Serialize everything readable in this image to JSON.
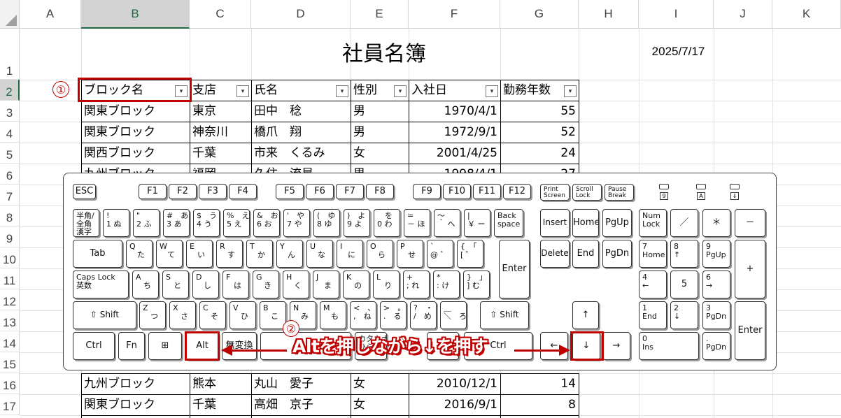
{
  "columns": [
    "A",
    "B",
    "C",
    "D",
    "E",
    "F",
    "G",
    "H",
    "I",
    "J",
    "K"
  ],
  "rows": [
    "1",
    "2",
    "3",
    "4",
    "5",
    "6",
    "7",
    "8",
    "9",
    "10",
    "11",
    "12",
    "13",
    "14",
    "15",
    "16",
    "17"
  ],
  "sheet_title": "社員名簿",
  "date": "2025/7/17",
  "headers": [
    "ブロック名",
    "支店",
    "氏名",
    "性別",
    "入社日",
    "勤務年数"
  ],
  "data_top": [
    [
      "関東ブロック",
      "東京",
      "田中　稔",
      "男",
      "1970/4/1",
      "55"
    ],
    [
      "関東ブロック",
      "神奈川",
      "橋爪　翔",
      "男",
      "1972/9/1",
      "52"
    ],
    [
      "関西ブロック",
      "千葉",
      "市来　くるみ",
      "女",
      "2001/4/25",
      "24"
    ],
    [
      "九州ブロック",
      "福岡",
      "久住　流星",
      "男",
      "1998/4/1",
      "27"
    ]
  ],
  "data_bottom": [
    [
      "九州ブロック",
      "熊本",
      "丸山　愛子",
      "女",
      "2010/12/1",
      "14"
    ],
    [
      "関東ブロック",
      "千葉",
      "高畑　京子",
      "女",
      "2016/9/1",
      "8"
    ]
  ],
  "markers": {
    "step1": "①",
    "step2": "②"
  },
  "callout": "Altを押しながら↓を押す",
  "colors": {
    "accent": "#c00000",
    "excel_green": "#1e6b41"
  },
  "keyboard": {
    "keys": [
      [
        "ESC"
      ],
      [
        "F1"
      ],
      [
        "F2"
      ],
      [
        "F3"
      ],
      [
        "F4"
      ],
      [
        "F5"
      ],
      [
        "F6"
      ],
      [
        "F7"
      ],
      [
        "F8"
      ],
      [
        "F9"
      ],
      [
        "F10"
      ],
      [
        "F11"
      ],
      [
        "F12"
      ],
      [
        "Print\nScreen"
      ],
      [
        "Scroll\nLock"
      ],
      [
        "Pause\nBreak"
      ],
      [
        "半角/\n全角\n漢字"
      ],
      [
        "!\n1 ぬ"
      ],
      [
        "\"\n2 ふ"
      ],
      [
        "#　あ\n3 あ"
      ],
      [
        "$　う\n4 う"
      ],
      [
        "%　え\n5 え"
      ],
      [
        "&　お\n6 お"
      ],
      [
        "'　や\n7 や"
      ],
      [
        "(　ゆ\n8 ゆ"
      ],
      [
        ")　よ\n9 よ"
      ],
      [
        "　を\n0 わ"
      ],
      [
        "=\n－ ほ"
      ],
      [
        "～\n＾ へ"
      ],
      [
        "|\n￥ ー"
      ],
      [
        "Back\nspace"
      ],
      [
        "Insert"
      ],
      [
        "Home"
      ],
      [
        "PgUp"
      ],
      [
        "Num\nLock"
      ],
      [
        "／"
      ],
      [
        "＊"
      ],
      [
        "－"
      ],
      [
        "Tab"
      ],
      [
        "Q\n　た"
      ],
      [
        "W\n　て"
      ],
      [
        "E\n　い"
      ],
      [
        "R\n　す"
      ],
      [
        "T\n　か"
      ],
      [
        "Y\n　ん"
      ],
      [
        "U\n　な"
      ],
      [
        "I\n　に"
      ],
      [
        "O\n　ら"
      ],
      [
        "P\n　せ"
      ],
      [
        "`\n@ ゛"
      ],
      [
        "{　「\n[ ゜"
      ],
      [
        "Enter"
      ],
      [
        "Delete"
      ],
      [
        "End"
      ],
      [
        "PgDn"
      ],
      [
        "7\nHome"
      ],
      [
        "8\n↑"
      ],
      [
        "9\nPgUp"
      ],
      [
        "+"
      ],
      [
        "Caps Lock\n英数"
      ],
      [
        "A\n　ち"
      ],
      [
        "S\n　と"
      ],
      [
        "D\n　し"
      ],
      [
        "F\n　は"
      ],
      [
        "G\n　き"
      ],
      [
        "H\n　く"
      ],
      [
        "J\n　ま"
      ],
      [
        "K\n　の"
      ],
      [
        "L\n　り"
      ],
      [
        "+\n; れ"
      ],
      [
        "*\n: け"
      ],
      [
        "}　」\n] む"
      ],
      [
        "4\n←"
      ],
      [
        "5"
      ],
      [
        "6\n→"
      ],
      [
        "⇧ Shift"
      ],
      [
        "Z\n　つ"
      ],
      [
        "X\n　さ"
      ],
      [
        "C\n　そ"
      ],
      [
        "V\n　ひ"
      ],
      [
        "B\n　こ"
      ],
      [
        "N\n　み"
      ],
      [
        "M\n　も"
      ],
      [
        "<　、\n,　ね"
      ],
      [
        ">　。\n.　る"
      ],
      [
        "?　・\n/　め"
      ],
      [
        "＿\n＼　ろ"
      ],
      [
        "⇧ Shift"
      ],
      [
        "↑"
      ],
      [
        "1\nEnd"
      ],
      [
        "2\n↓"
      ],
      [
        "3\nPgDn"
      ],
      [
        "Enter"
      ],
      [
        "Ctrl"
      ],
      [
        "Fn"
      ],
      [
        "⊞"
      ],
      [
        "Alt"
      ],
      [
        "無変換"
      ],
      [
        ""
      ],
      [
        "カタカナ\nひらがな"
      ],
      [
        "Alt"
      ],
      [
        "Ctrl"
      ],
      [
        "←"
      ],
      [
        "↓"
      ],
      [
        "→"
      ],
      [
        "0\nIns"
      ],
      [
        ".\nPgDn"
      ]
    ],
    "led_labels": [
      "9",
      "A",
      "⇓"
    ]
  }
}
